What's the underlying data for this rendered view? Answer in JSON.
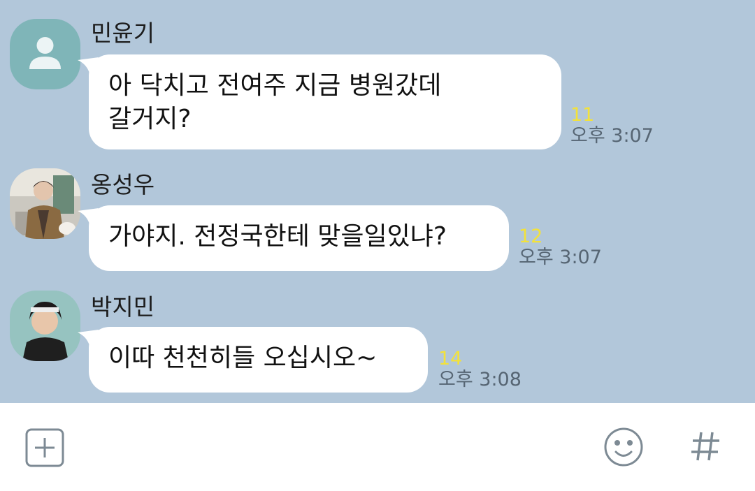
{
  "messages": [
    {
      "sender": "민윤기",
      "text": "아 닥치고 전여주 지금 병원갔데\n갈거지?",
      "unread": "11",
      "time": "오후 3:07",
      "avatar": "default-profile"
    },
    {
      "sender": "옹성우",
      "text": "가야지. 전정국한테 맞을일있냐?",
      "unread": "12",
      "time": "오후 3:07",
      "avatar": "photo-profile"
    },
    {
      "sender": "박지민",
      "text": "이따 천천히들 오십시오~",
      "unread": "14",
      "time": "오후 3:08",
      "avatar": "photo-profile"
    }
  ],
  "input_bar": {
    "icons": [
      "plus-icon",
      "emoji-icon",
      "hashtag-icon"
    ]
  },
  "colors": {
    "chat_background": "#b2c7da",
    "bubble": "#ffffff",
    "unread_count": "#f3e23a",
    "time": "#566573",
    "default_avatar": "#7fb5b8"
  }
}
